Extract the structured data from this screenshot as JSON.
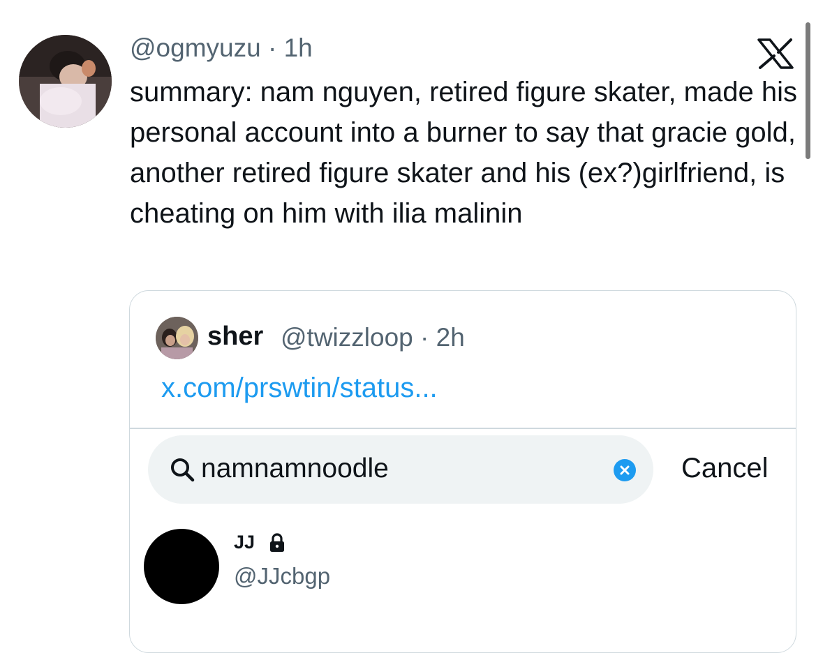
{
  "tweet": {
    "handle_line": "@ogmyuzu · 1h",
    "text": "summary: nam nguyen, retired figure skater, made his personal account into a burner to say that gracie gold, another retired figure skater and his (ex?)girlfriend, is cheating on him with ilia malinin",
    "avatar_icon": "user-avatar-photo",
    "close_icon": "x-logo-icon"
  },
  "quote": {
    "name": "sher",
    "meta": "@twizzloop · 2h",
    "link": "x.com/prswtin/status..."
  },
  "search": {
    "query": "namnamnoodle",
    "cancel_label": "Cancel",
    "icon": "search-icon",
    "clear_icon": "clear-icon"
  },
  "result": {
    "name": "JJ",
    "handle": "@JJcbgp",
    "lock_icon": "lock-icon"
  },
  "colors": {
    "text": "#0f1419",
    "secondary": "#536471",
    "link": "#1d9bf0",
    "border": "#cfd9de",
    "search_bg": "#eff3f4"
  }
}
